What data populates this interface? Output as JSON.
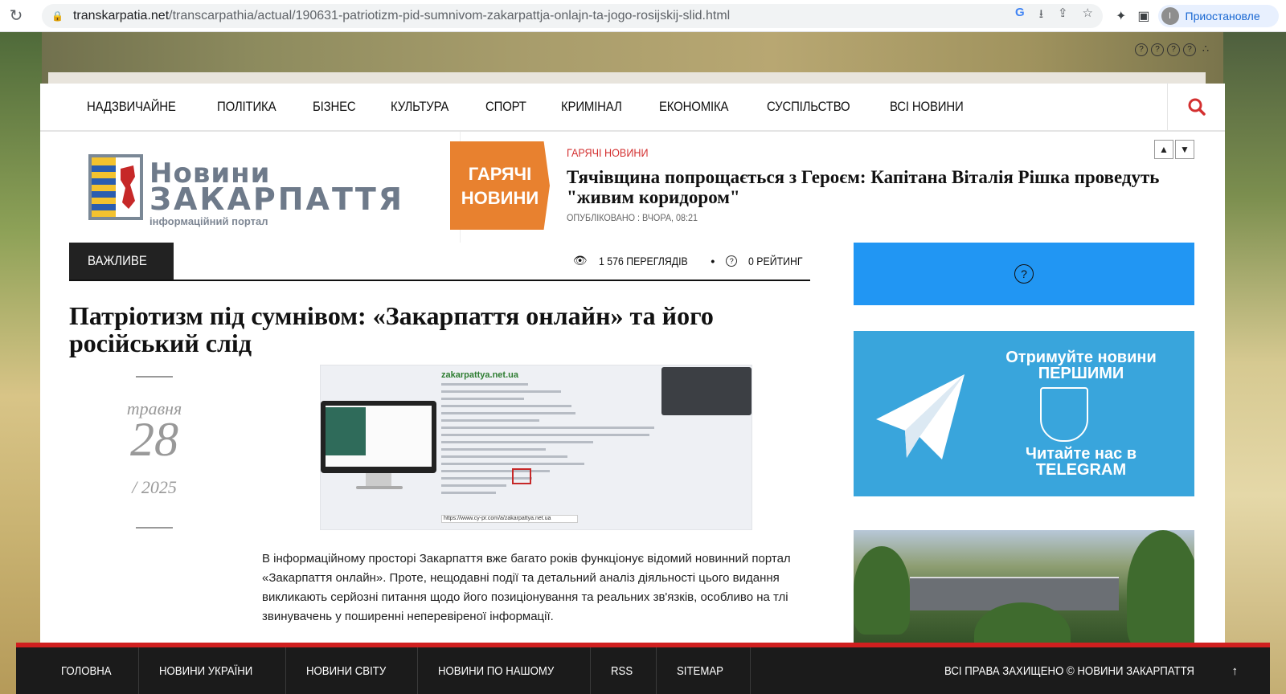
{
  "browser": {
    "url_host": "transkarpatia.net",
    "url_path": "/transcarpathia/actual/190631-patriotizm-pid-sumnivom-zakarpattja-onlajn-ta-jogo-rosijskij-slid.html",
    "profile_avatar": "I",
    "profile_label": "Приостановле"
  },
  "nav": {
    "items": [
      "НАДЗВИЧАЙНЕ",
      "ПОЛІТИКА",
      "БІЗНЕС",
      "КУЛЬТУРА",
      "СПОРТ",
      "КРИМІНАЛ",
      "ЕКОНОМІКА",
      "СУСПІЛЬСТВО",
      "ВСІ НОВИНИ"
    ]
  },
  "logo": {
    "line1": "Новини",
    "line2": "ЗАКАРПАТТЯ",
    "line3": "інформаційний портал"
  },
  "hot": {
    "badge_line1": "ГАРЯЧІ",
    "badge_line2": "НОВИНИ",
    "label": "ГАРЯЧІ НОВИНИ",
    "title": "Тячівщина попрощається з Героєм: Капітана Віталія Рішка проведуть \"живим коридором\"",
    "meta": "ОПУБЛІКОВАНО : ВЧОРА, 08:21"
  },
  "article": {
    "category": "ВАЖЛИВЕ",
    "views": "1 576 ПЕРЕГЛЯДІВ",
    "rating": "0 РЕЙТИНГ",
    "headline": "Патріотизм під сумнівом: «Закарпаття онлайн» та його російський слід",
    "date_month": "травня",
    "date_day": "28",
    "date_year": "2025",
    "image_site": "zakarpattya.net.ua",
    "image_url": "https://www.cy-pr.com/a/zakarpattya.net.ua",
    "body": "В інформаційному просторі Закарпаття вже багато років функціонує відомий новинний портал «Закарпаття онлайн». Проте, нещодавні події та детальний аналіз діяльності цього видання викликають серйозні питання щодо його позиціонування та реальних зв'язків, особливо на тлі звинувачень у поширенні неперевіреної інформації."
  },
  "sidebar": {
    "telegram": {
      "line1": "Отримуйте новини",
      "line2": "ПЕРШИМИ",
      "line3": "Читайте нас в",
      "line4": "TELEGRAM"
    }
  },
  "footer": {
    "links": [
      "ГОЛОВНА",
      "НОВИНИ УКРАЇНИ",
      "НОВИНИ СВІТУ",
      "НОВИНИ ПО НАШОМУ",
      "RSS",
      "SITEMAP"
    ],
    "copyright": "ВСІ ПРАВА ЗАХИЩЕНО © НОВИНИ ЗАКАРПАТТЯ"
  },
  "colors": {
    "accent_red": "#d01f1f",
    "hot_orange": "#e8812f",
    "sidebar_blue": "#2196f3",
    "telegram_blue": "#39a5dc"
  }
}
